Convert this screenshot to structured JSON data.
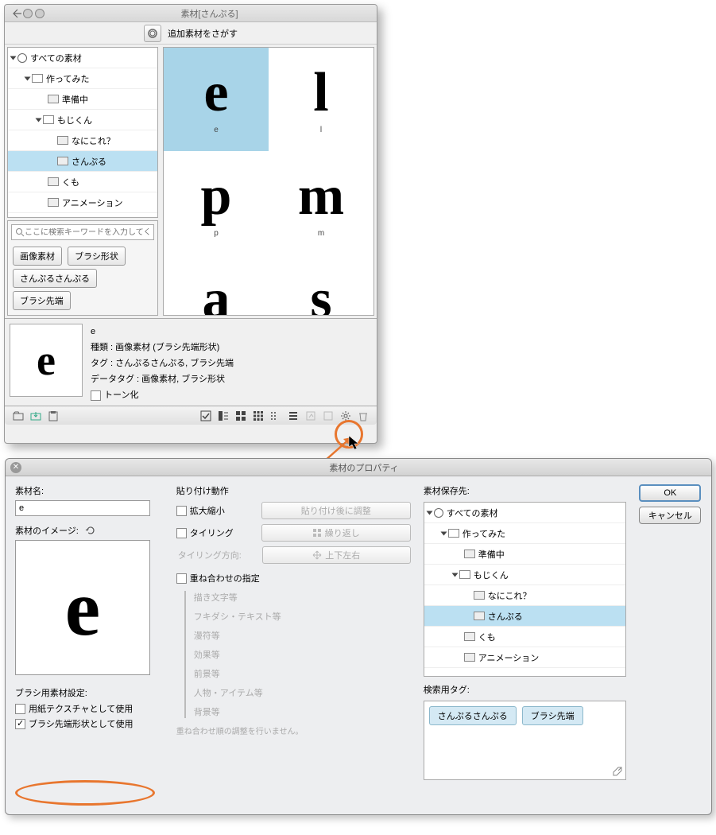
{
  "top": {
    "title": "素材[さんぷる]",
    "search_more": "追加素材をさがす",
    "tree": {
      "root": "すべての素材",
      "n1": "作ってみた",
      "n2": "準備中",
      "n3": "もじくん",
      "n4": "なにこれ？",
      "n5": "さんぷる",
      "n6": "くも",
      "n7": "アニメーション"
    },
    "search_placeholder": "ここに検索キーワードを入力してください",
    "tags": {
      "t1": "画像素材",
      "t2": "ブラシ形状",
      "t3": "さんぷるさんぷる",
      "t4": "ブラシ先端"
    },
    "glyphs": {
      "g1": "e",
      "g2": "l",
      "g3": "p",
      "g4": "m",
      "g5": "a",
      "g6": "s"
    },
    "detail": {
      "name": "e",
      "kind": "種類 : 画像素材 (ブラシ先端形状)",
      "tag": "タグ : さんぷるさんぷる, ブラシ先端",
      "datatag": "データタグ : 画像素材, ブラシ形状",
      "tone": "トーン化"
    }
  },
  "dlg": {
    "title": "素材のプロパティ",
    "name_label": "素材名:",
    "name_value": "e",
    "image_label": "素材のイメージ:",
    "brush_label": "ブラシ用素材設定:",
    "chk_paper": "用紙テクスチャとして使用",
    "chk_tip": "ブラシ先端形状として使用",
    "paste_label": "貼り付け動作",
    "scale": "拡大縮小",
    "tiling": "タイリング",
    "tiling_dir": "タイリング方向:",
    "dd1": "貼り付け後に調整",
    "dd2": "繰り返し",
    "dd3": "上下左右",
    "overlay": "重ね合わせの指定",
    "layers": {
      "l1": "描き文字等",
      "l2": "フキダシ・テキスト等",
      "l3": "漫符等",
      "l4": "効果等",
      "l5": "前景等",
      "l6": "人物・アイテム等",
      "l7": "背景等"
    },
    "note": "重ね合わせ順の調整を行いません。",
    "save_label": "素材保存先:",
    "tags_label": "検索用タグ:",
    "tag1": "さんぷるさんぷる",
    "tag2": "ブラシ先端",
    "ok": "OK",
    "cancel": "キャンセル"
  }
}
